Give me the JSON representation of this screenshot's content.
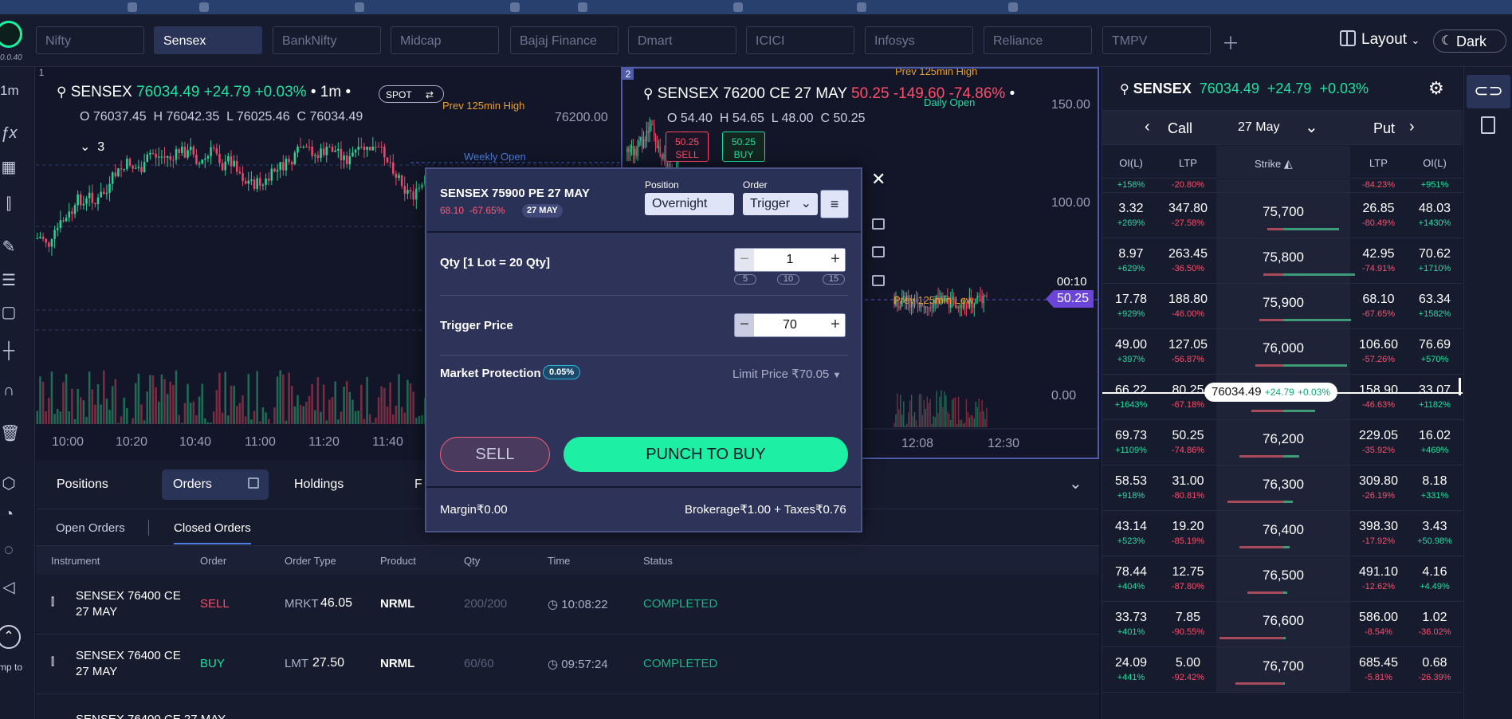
{
  "app_version": "0.0.40",
  "watchlist": [
    "Nifty",
    "Sensex",
    "BankNifty",
    "Midcap",
    "Bajaj Finance",
    "Dmart",
    "ICICI",
    "Infosys",
    "Reliance",
    "TMPV"
  ],
  "header": {
    "layout_label": "Layout",
    "theme_label": "Dark"
  },
  "sidebar": {
    "interval": "1m",
    "jump_label": "mp to"
  },
  "chart1": {
    "panel": "1",
    "symbol": "SENSEX",
    "ltp": "76034.49",
    "change": "+24.79",
    "change_pct": "+0.03%",
    "interval": "1m",
    "mode": "SPOT",
    "open": "O 76037.45",
    "high": "H 76042.35",
    "low": "L 76025.46",
    "close": "C 76034.49",
    "indicator_count": "3",
    "level_high": "Prev 125min High",
    "level_weekly": "Weekly Open",
    "price_tick": "76200.00",
    "x_ticks": [
      "10:00",
      "10:20",
      "10:40",
      "11:00",
      "11:20",
      "11:40"
    ]
  },
  "chart2": {
    "panel": "2",
    "symbol": "SENSEX 76200 CE 27 MAY",
    "ltp": "50.25",
    "change": "-149.60",
    "change_pct": "-74.86%",
    "open": "O 54.40",
    "high": "H 54.65",
    "low": "L 48.00",
    "close": "C 50.25",
    "sell_price": "50.25",
    "sell_label": "SELL",
    "buy_price": "50.25",
    "buy_label": "BUY",
    "level_high": "Prev 125min High",
    "level_daily": "Daily Open",
    "level_low": "Prev 125min Low",
    "y_ticks": [
      "150.00",
      "100.00",
      "0.00"
    ],
    "timer": "00:10",
    "price_tag": "50.25",
    "x_ticks": [
      "12:08",
      "12:30"
    ]
  },
  "order_modal": {
    "instrument": "SENSEX 75900 PE 27 MAY",
    "ltp": "68.10",
    "change_pct": "-67.65%",
    "expiry_badge": "27 MAY",
    "position_label": "Position",
    "position_value": "Overnight",
    "order_label": "Order",
    "order_value": "Trigger",
    "qty_label": "Qty [1 Lot = 20 Qty]",
    "qty_value": "1",
    "qty_presets": [
      "5",
      "10",
      "15"
    ],
    "trigger_label": "Trigger Price",
    "trigger_value": "70",
    "protection_label": "Market Protection",
    "protection_value": "0.05%",
    "limit_price": "Limit Price ₹70.05",
    "sell_label": "SELL",
    "buy_label": "PUNCH TO BUY",
    "margin": "Margin₹0.00",
    "charges": "Brokerage₹1.00 + Taxes₹0.76"
  },
  "bottom": {
    "tabs": [
      "Positions",
      "Orders",
      "Holdings",
      "F"
    ],
    "subtabs": [
      "Open Orders",
      "Closed Orders"
    ],
    "columns": [
      "Instrument",
      "Order",
      "Order Type",
      "Product",
      "Qty",
      "Time",
      "Status"
    ],
    "rows": [
      {
        "instrument": "SENSEX 76400 CE 27 MAY",
        "side": "SELL",
        "type": "MRKT",
        "price": "46.05",
        "product": "NRML",
        "qty": "200/200",
        "time": "10:08:22",
        "status": "COMPLETED"
      },
      {
        "instrument": "SENSEX 76400 CE 27 MAY",
        "side": "BUY",
        "type": "LMT",
        "price": "27.50",
        "product": "NRML",
        "qty": "60/60",
        "time": "09:57:24",
        "status": "COMPLETED"
      }
    ]
  },
  "option_chain": {
    "symbol": "SENSEX",
    "ltp": "76034.49",
    "change": "+24.79",
    "change_pct": "+0.03%",
    "call_label": "Call",
    "expiry": "27 May",
    "put_label": "Put",
    "headers": [
      "OI(L)",
      "LTP",
      "Strike",
      "LTP",
      "OI(L)"
    ],
    "top_partial": {
      "call_oi_pct": "+158%",
      "call_ltp_pct": "-20.80%",
      "put_ltp_pct": "-84.23%",
      "put_oi_pct": "+951%"
    },
    "spot_pill": {
      "ltp": "76034.49",
      "change": "+24.79",
      "change_pct": "+0.03%"
    },
    "rows": [
      {
        "coi": "3.32",
        "coip": "+269%",
        "cltp": "347.80",
        "cltpp": "-27.58%",
        "strike": "75,700",
        "pltp": "26.85",
        "pltpp": "-80.49%",
        "poi": "48.03",
        "poip": "+1430%"
      },
      {
        "coi": "8.97",
        "coip": "+629%",
        "cltp": "263.45",
        "cltpp": "-36.50%",
        "strike": "75,800",
        "pltp": "42.95",
        "pltpp": "-74.91%",
        "poi": "70.62",
        "poip": "+1710%"
      },
      {
        "coi": "17.78",
        "coip": "+929%",
        "cltp": "188.80",
        "cltpp": "-46.00%",
        "strike": "75,900",
        "pltp": "68.10",
        "pltpp": "-67.65%",
        "poi": "63.34",
        "poip": "+1582%"
      },
      {
        "coi": "49.00",
        "coip": "+397%",
        "cltp": "127.05",
        "cltpp": "-56.87%",
        "strike": "76,000",
        "pltp": "106.60",
        "pltpp": "-57.26%",
        "poi": "76.69",
        "poip": "+570%"
      },
      {
        "coi": "66.22",
        "coip": "+1643%",
        "cltp": "80.25",
        "cltpp": "-67.18%",
        "strike": "76,100",
        "pltp": "158.90",
        "pltpp": "-46.63%",
        "poi": "33.07",
        "poip": "+1182%"
      },
      {
        "coi": "69.73",
        "coip": "+1109%",
        "cltp": "50.25",
        "cltpp": "-74.86%",
        "strike": "76,200",
        "pltp": "229.05",
        "pltpp": "-35.92%",
        "poi": "16.02",
        "poip": "+469%"
      },
      {
        "coi": "58.53",
        "coip": "+918%",
        "cltp": "31.00",
        "cltpp": "-80.81%",
        "strike": "76,300",
        "pltp": "309.80",
        "pltpp": "-26.19%",
        "poi": "8.18",
        "poip": "+331%"
      },
      {
        "coi": "43.14",
        "coip": "+523%",
        "cltp": "19.20",
        "cltpp": "-85.19%",
        "strike": "76,400",
        "pltp": "398.30",
        "pltpp": "-17.92%",
        "poi": "3.43",
        "poip": "+50.98%"
      },
      {
        "coi": "78.44",
        "coip": "+404%",
        "cltp": "12.75",
        "cltpp": "-87.80%",
        "strike": "76,500",
        "pltp": "491.10",
        "pltpp": "-12.62%",
        "poi": "4.16",
        "poip": "+4.49%"
      },
      {
        "coi": "33.73",
        "coip": "+401%",
        "cltp": "7.85",
        "cltpp": "-90.55%",
        "strike": "76,600",
        "pltp": "586.00",
        "pltpp": "-8.54%",
        "poi": "1.02",
        "poip": "-36.02%"
      },
      {
        "coi": "24.09",
        "coip": "+441%",
        "cltp": "5.00",
        "cltpp": "-92.42%",
        "strike": "76,700",
        "pltp": "685.45",
        "pltpp": "-5.81%",
        "poi": "0.68",
        "poip": "-26.39%"
      }
    ]
  },
  "colors": {
    "accent": "#1df0a5",
    "negative": "#ff4d6a",
    "panel": "#171b2e",
    "highlight": "#2a3358"
  }
}
